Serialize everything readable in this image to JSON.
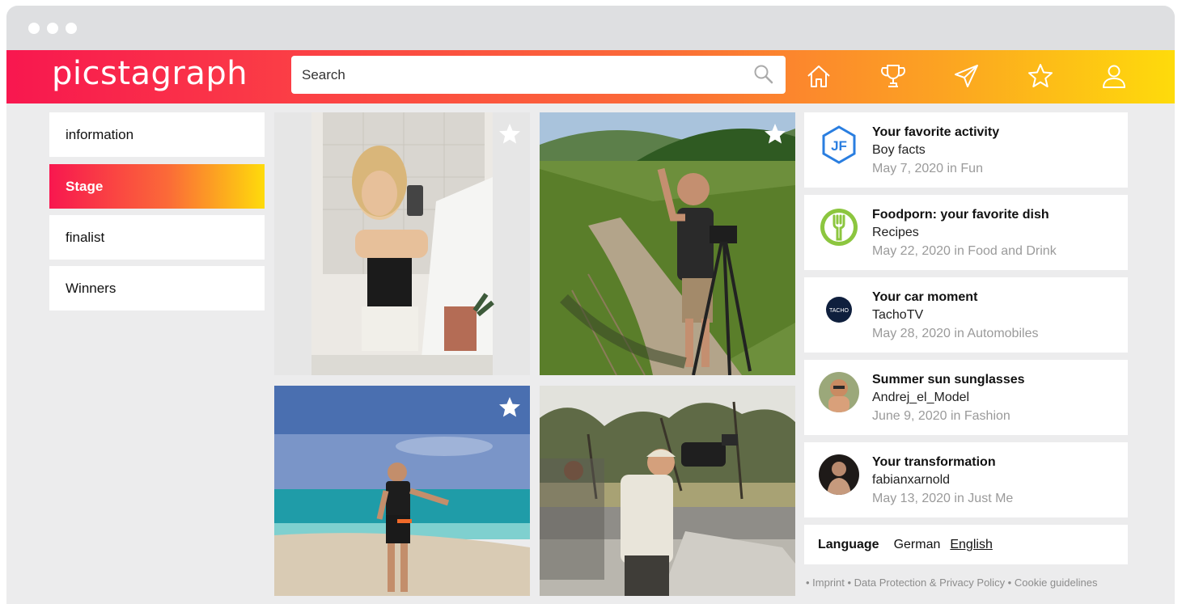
{
  "header": {
    "logo_text": "picstagraph",
    "search_placeholder": "Search",
    "nav_icons": [
      "home-icon",
      "trophy-icon",
      "send-icon",
      "star-icon",
      "user-icon"
    ]
  },
  "sidebar": {
    "items": [
      {
        "label": "information",
        "active": false
      },
      {
        "label": "Stage",
        "active": true
      },
      {
        "label": "finalist",
        "active": false
      },
      {
        "label": "Winners",
        "active": false
      }
    ]
  },
  "feed": {
    "photos": [
      {
        "name": "selfie-photo",
        "favorite_icon": "star-icon"
      },
      {
        "name": "vineyard-photo",
        "favorite_icon": "star-icon"
      },
      {
        "name": "beach-photo",
        "favorite_icon": "star-icon"
      },
      {
        "name": "safari-photo",
        "favorite_icon": null
      }
    ]
  },
  "activities": [
    {
      "title": "Your favorite activity",
      "subtitle": "Boy facts",
      "meta": "May 7, 2020 in Fun"
    },
    {
      "title": "Foodporn: your favorite dish",
      "subtitle": "Recipes",
      "meta": "May 22, 2020 in Food and Drink"
    },
    {
      "title": "Your car moment",
      "subtitle": "TachoTV",
      "meta": "May 28, 2020 in Automobiles"
    },
    {
      "title": "Summer sun sunglasses",
      "subtitle": "Andrej_el_Model",
      "meta": "June 9, 2020 in Fashion"
    },
    {
      "title": "Your transformation",
      "subtitle": "fabianxarnold",
      "meta": "May 13, 2020 in Just Me"
    }
  ],
  "avatars": {
    "jf_text": "JF",
    "tacho_text": "TACHO"
  },
  "language": {
    "label": "Language",
    "options": [
      "German",
      "English"
    ],
    "selected": "English"
  },
  "footer": {
    "text": "• Imprint • Data Protection & Privacy Policy • Cookie guidelines"
  },
  "colors": {
    "gradient_start": "#f8174f",
    "gradient_mid": "#fb6a38",
    "gradient_end": "#fedb0b"
  }
}
